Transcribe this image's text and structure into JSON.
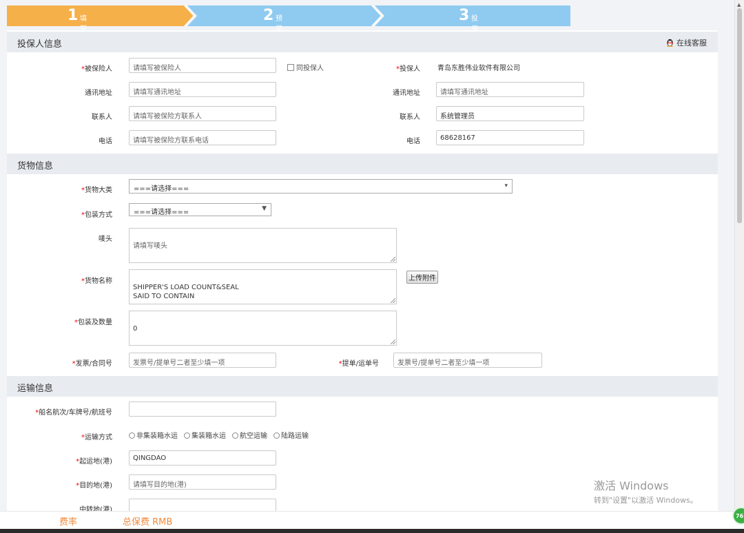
{
  "steps": [
    {
      "num": "1",
      "label": "填写投保信息",
      "color": "#f5b04a"
    },
    {
      "num": "2",
      "label": "预览确认",
      "color": "#8fcaf0"
    },
    {
      "num": "3",
      "label": "投保完成",
      "color": "#8fcaf0"
    }
  ],
  "insurer_section": {
    "title": "投保人信息",
    "online_service": "在线客服",
    "insured_label": "被保险人",
    "insured_placeholder": "请填写被保险人",
    "same_as_applicant": "同投保人",
    "applicant_label": "投保人",
    "applicant_value": "青岛东胜伟业软件有限公司",
    "address_label": "通讯地址",
    "address_placeholder": "请填写通讯地址",
    "address_right_label": "通讯地址",
    "address_right_placeholder": "请填写通讯地址",
    "contact_label": "联系人",
    "contact_placeholder": "请填写被保险方联系人",
    "contact_right_label": "联系人",
    "contact_right_value": "系统管理员",
    "phone_label": "电话",
    "phone_placeholder": "请填写被保险方联系电话",
    "phone_right_label": "电话",
    "phone_right_value": "68628167"
  },
  "cargo_section": {
    "title": "货物信息",
    "category_label": "货物大类",
    "category_value": "===请选择===",
    "packing_label": "包装方式",
    "packing_value": "===请选择===",
    "marks_label": "唛头",
    "marks_placeholder": "请填写唛头",
    "goods_name_label": "货物名称",
    "goods_name_value": "SHIPPER'S LOAD COUNT&SEAL\nSAID TO CONTAIN",
    "upload_button": "上传附件",
    "quantity_label": "包装及数量",
    "quantity_value": "0",
    "invoice_label": "发票/合同号",
    "invoice_placeholder": "发票号/提单号二者至少填一项",
    "bl_label": "提单/运单号",
    "bl_placeholder": "发票号/提单号二者至少填一项"
  },
  "transport_section": {
    "title": "运输信息",
    "vessel_label": "船名航次/车牌号/航班号",
    "vessel_value": "",
    "mode_label": "运输方式",
    "modes": [
      "非集装箱水运",
      "集装箱水运",
      "航空运输",
      "陆路运输"
    ],
    "origin_label": "起运地(港)",
    "origin_value": "QINGDAO",
    "destination_label": "目的地(港)",
    "destination_placeholder": "请填写目的地(港)",
    "transit_label": "中转地(港)"
  },
  "footer": {
    "rate_label": "费率",
    "total_label": "总保费 RMB"
  },
  "watermark": {
    "line1": "激活 Windows",
    "line2": "转到\"设置\"以激活 Windows。"
  },
  "badge": "76"
}
